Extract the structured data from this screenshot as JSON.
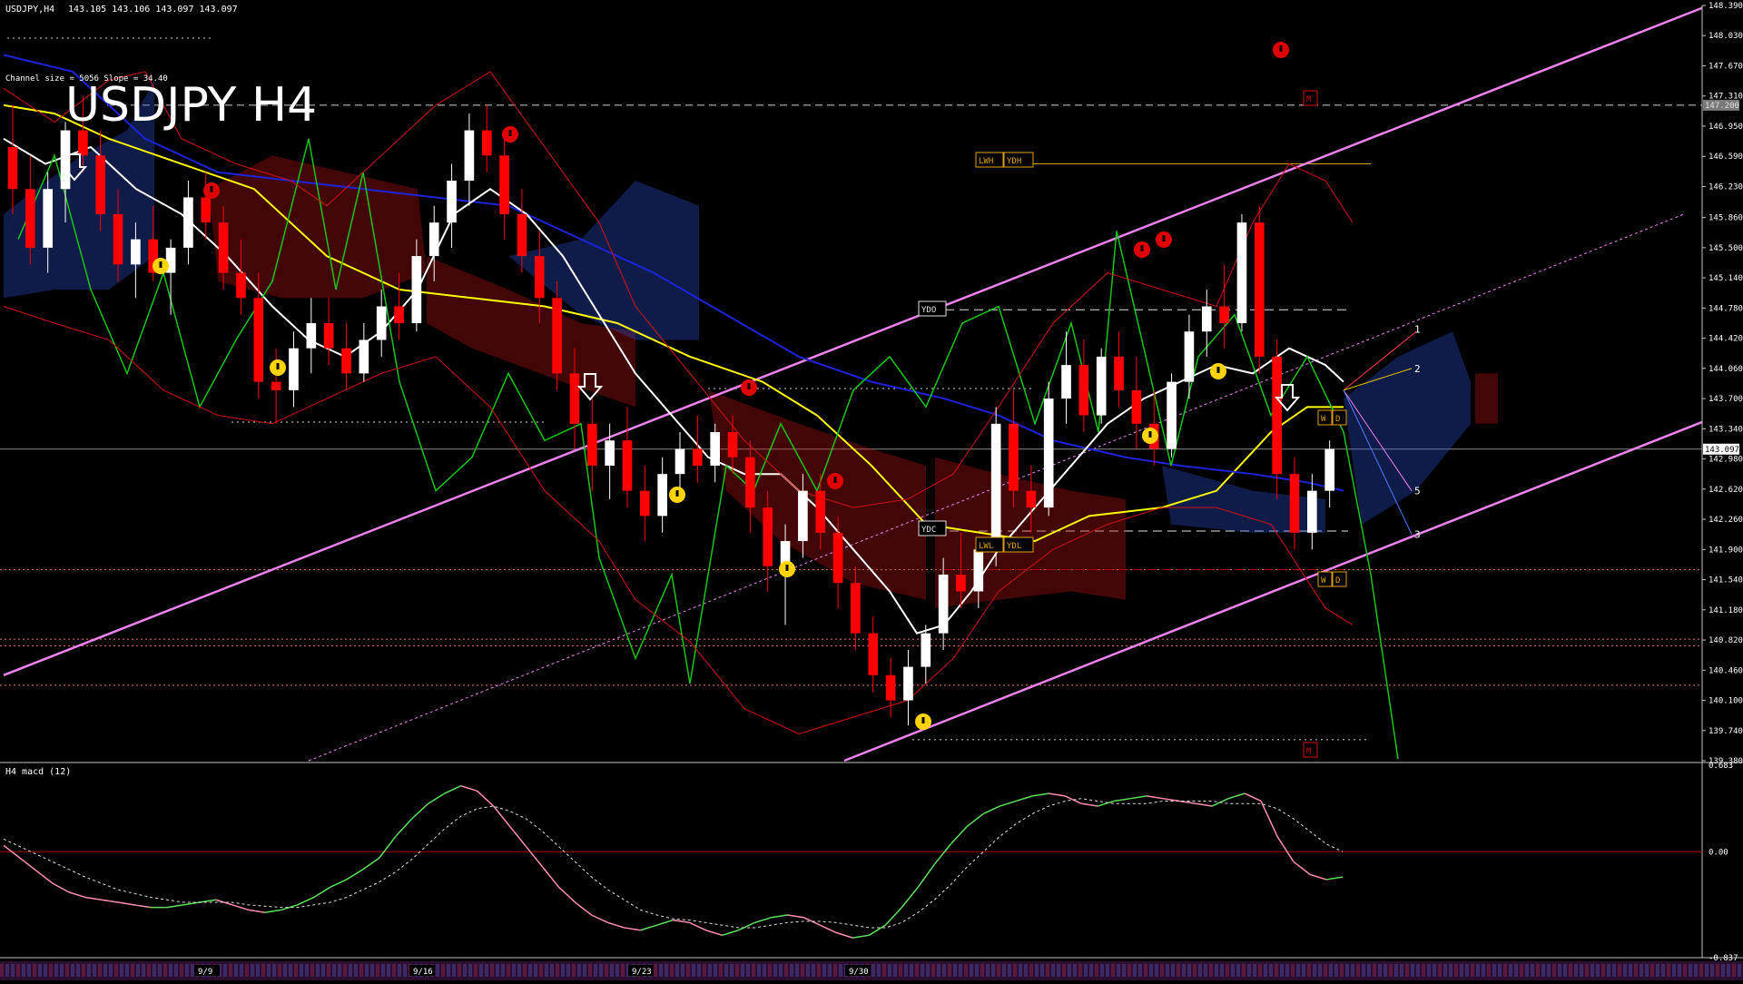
{
  "header": {
    "symbol_line": "USDJPY,H4",
    "ohlc": "143.105 143.106 143.097 143.097",
    "channel_info": "Channel size = 5056 Slope = 34.40"
  },
  "title": "USDJPY H4",
  "colors": {
    "background": "#000000",
    "bull": "#ffffff",
    "bear": "#ff0000",
    "channel": "#ee82ee",
    "ma_white": "#ffffff",
    "ma_yellow": "#ffff00",
    "ma_blue": "#1e22d8",
    "green_line": "#19c419",
    "macd_up": "#5ee05e",
    "macd_down": "#ff8fb0",
    "zero_line": "#b00000",
    "level_gray": "#cfcfcf",
    "level_pink": "#e07070",
    "level_orange": "#ffaa00"
  },
  "chart_data": {
    "type": "candlestick",
    "symbol": "USDJPY",
    "timeframe": "H4",
    "current_price": 143.097,
    "y_ticks": [
      "148.390",
      "148.030",
      "147.670",
      "147.310",
      "146.950",
      "146.590",
      "146.230",
      "145.860",
      "145.500",
      "145.140",
      "144.780",
      "144.420",
      "144.060",
      "143.700",
      "143.340",
      "142.980",
      "142.620",
      "142.260",
      "141.900",
      "141.540",
      "141.180",
      "140.820",
      "140.460",
      "140.100",
      "139.740",
      "139.380"
    ],
    "ylim": [
      139.38,
      148.39
    ],
    "price_label": "143.097",
    "label_147": "147.200",
    "x_labels": [
      "9/9",
      "9/16",
      "9/23",
      "9/30"
    ],
    "candles": [
      {
        "o": 146.7,
        "h": 147.2,
        "l": 145.9,
        "c": 146.2
      },
      {
        "o": 146.2,
        "h": 146.6,
        "l": 145.3,
        "c": 145.5
      },
      {
        "o": 145.5,
        "h": 146.4,
        "l": 145.2,
        "c": 146.2
      },
      {
        "o": 146.2,
        "h": 147.0,
        "l": 145.8,
        "c": 146.9
      },
      {
        "o": 146.9,
        "h": 147.3,
        "l": 146.4,
        "c": 146.6
      },
      {
        "o": 146.6,
        "h": 146.9,
        "l": 145.7,
        "c": 145.9
      },
      {
        "o": 145.9,
        "h": 146.2,
        "l": 145.1,
        "c": 145.3
      },
      {
        "o": 145.3,
        "h": 145.8,
        "l": 144.9,
        "c": 145.6
      },
      {
        "o": 145.6,
        "h": 146.0,
        "l": 145.1,
        "c": 145.2
      },
      {
        "o": 145.2,
        "h": 145.6,
        "l": 144.7,
        "c": 145.5
      },
      {
        "o": 145.5,
        "h": 146.3,
        "l": 145.3,
        "c": 146.1
      },
      {
        "o": 146.1,
        "h": 146.4,
        "l": 145.6,
        "c": 145.8
      },
      {
        "o": 145.8,
        "h": 146.0,
        "l": 145.0,
        "c": 145.2
      },
      {
        "o": 145.2,
        "h": 145.6,
        "l": 144.7,
        "c": 144.9
      },
      {
        "o": 144.9,
        "h": 145.2,
        "l": 143.7,
        "c": 143.9
      },
      {
        "o": 143.9,
        "h": 144.3,
        "l": 143.4,
        "c": 143.8
      },
      {
        "o": 143.8,
        "h": 144.5,
        "l": 143.6,
        "c": 144.3
      },
      {
        "o": 144.3,
        "h": 144.9,
        "l": 144.0,
        "c": 144.6
      },
      {
        "o": 144.6,
        "h": 144.9,
        "l": 144.1,
        "c": 144.3
      },
      {
        "o": 144.3,
        "h": 144.6,
        "l": 143.8,
        "c": 144.0
      },
      {
        "o": 144.0,
        "h": 144.6,
        "l": 143.9,
        "c": 144.4
      },
      {
        "o": 144.4,
        "h": 145.0,
        "l": 144.2,
        "c": 144.8
      },
      {
        "o": 144.8,
        "h": 145.2,
        "l": 144.4,
        "c": 144.6
      },
      {
        "o": 144.6,
        "h": 145.6,
        "l": 144.5,
        "c": 145.4
      },
      {
        "o": 145.4,
        "h": 146.0,
        "l": 145.1,
        "c": 145.8
      },
      {
        "o": 145.8,
        "h": 146.5,
        "l": 145.5,
        "c": 146.3
      },
      {
        "o": 146.3,
        "h": 147.1,
        "l": 146.0,
        "c": 146.9
      },
      {
        "o": 146.9,
        "h": 147.2,
        "l": 146.4,
        "c": 146.6
      },
      {
        "o": 146.6,
        "h": 146.8,
        "l": 145.6,
        "c": 145.9
      },
      {
        "o": 145.9,
        "h": 146.2,
        "l": 145.2,
        "c": 145.4
      },
      {
        "o": 145.4,
        "h": 145.7,
        "l": 144.6,
        "c": 144.9
      },
      {
        "o": 144.9,
        "h": 145.1,
        "l": 143.8,
        "c": 144.0
      },
      {
        "o": 144.0,
        "h": 144.3,
        "l": 143.1,
        "c": 143.4
      },
      {
        "o": 143.4,
        "h": 143.7,
        "l": 142.6,
        "c": 142.9
      },
      {
        "o": 142.9,
        "h": 143.4,
        "l": 142.5,
        "c": 143.2
      },
      {
        "o": 143.2,
        "h": 143.6,
        "l": 142.4,
        "c": 142.6
      },
      {
        "o": 142.6,
        "h": 142.9,
        "l": 142.0,
        "c": 142.3
      },
      {
        "o": 142.3,
        "h": 143.0,
        "l": 142.1,
        "c": 142.8
      },
      {
        "o": 142.8,
        "h": 143.3,
        "l": 142.6,
        "c": 143.1
      },
      {
        "o": 143.1,
        "h": 143.5,
        "l": 142.7,
        "c": 142.9
      },
      {
        "o": 142.9,
        "h": 143.4,
        "l": 142.7,
        "c": 143.3
      },
      {
        "o": 143.3,
        "h": 143.5,
        "l": 142.8,
        "c": 143.0
      },
      {
        "o": 143.0,
        "h": 143.2,
        "l": 142.1,
        "c": 142.4
      },
      {
        "o": 142.4,
        "h": 142.6,
        "l": 141.4,
        "c": 141.7
      },
      {
        "o": 141.7,
        "h": 142.2,
        "l": 141.0,
        "c": 142.0
      },
      {
        "o": 142.0,
        "h": 142.8,
        "l": 141.8,
        "c": 142.6
      },
      {
        "o": 142.6,
        "h": 142.8,
        "l": 141.9,
        "c": 142.1
      },
      {
        "o": 142.1,
        "h": 142.3,
        "l": 141.2,
        "c": 141.5
      },
      {
        "o": 141.5,
        "h": 141.7,
        "l": 140.7,
        "c": 140.9
      },
      {
        "o": 140.9,
        "h": 141.1,
        "l": 140.2,
        "c": 140.4
      },
      {
        "o": 140.4,
        "h": 140.6,
        "l": 139.9,
        "c": 140.1
      },
      {
        "o": 140.1,
        "h": 140.7,
        "l": 139.8,
        "c": 140.5
      },
      {
        "o": 140.5,
        "h": 141.0,
        "l": 140.3,
        "c": 140.9
      },
      {
        "o": 140.9,
        "h": 141.8,
        "l": 140.7,
        "c": 141.6
      },
      {
        "o": 141.6,
        "h": 142.1,
        "l": 141.2,
        "c": 141.4
      },
      {
        "o": 141.4,
        "h": 142.0,
        "l": 141.2,
        "c": 141.9
      },
      {
        "o": 141.9,
        "h": 143.6,
        "l": 141.7,
        "c": 143.4
      },
      {
        "o": 143.4,
        "h": 143.8,
        "l": 142.4,
        "c": 142.6
      },
      {
        "o": 142.6,
        "h": 142.9,
        "l": 142.1,
        "c": 142.4
      },
      {
        "o": 142.4,
        "h": 143.9,
        "l": 142.3,
        "c": 143.7
      },
      {
        "o": 143.7,
        "h": 144.5,
        "l": 143.4,
        "c": 144.1
      },
      {
        "o": 144.1,
        "h": 144.4,
        "l": 143.3,
        "c": 143.5
      },
      {
        "o": 143.5,
        "h": 144.3,
        "l": 143.4,
        "c": 144.2
      },
      {
        "o": 144.2,
        "h": 144.5,
        "l": 143.6,
        "c": 143.8
      },
      {
        "o": 143.8,
        "h": 144.2,
        "l": 143.1,
        "c": 143.4
      },
      {
        "o": 143.4,
        "h": 143.8,
        "l": 142.9,
        "c": 143.1
      },
      {
        "o": 143.1,
        "h": 144.0,
        "l": 143.0,
        "c": 143.9
      },
      {
        "o": 143.9,
        "h": 144.7,
        "l": 143.7,
        "c": 144.5
      },
      {
        "o": 144.5,
        "h": 145.0,
        "l": 144.2,
        "c": 144.8
      },
      {
        "o": 144.8,
        "h": 145.3,
        "l": 144.3,
        "c": 144.6
      },
      {
        "o": 144.6,
        "h": 145.9,
        "l": 144.5,
        "c": 145.8
      },
      {
        "o": 145.8,
        "h": 146.0,
        "l": 144.0,
        "c": 144.2
      },
      {
        "o": 144.2,
        "h": 144.4,
        "l": 142.5,
        "c": 142.8
      },
      {
        "o": 142.8,
        "h": 143.0,
        "l": 141.9,
        "c": 142.1
      },
      {
        "o": 142.1,
        "h": 142.8,
        "l": 141.9,
        "c": 142.6
      },
      {
        "o": 142.6,
        "h": 143.2,
        "l": 142.4,
        "c": 143.1
      }
    ],
    "macd": {
      "name": "H4 macd (12)",
      "ylim": [
        -0.837,
        0.683
      ],
      "y_ticks": [
        "0.683",
        "0.00",
        "-0.837"
      ],
      "main": [
        0.05,
        -0.05,
        -0.15,
        -0.25,
        -0.32,
        -0.36,
        -0.38,
        -0.4,
        -0.42,
        -0.44,
        -0.44,
        -0.42,
        -0.4,
        -0.38,
        -0.42,
        -0.46,
        -0.48,
        -0.46,
        -0.42,
        -0.36,
        -0.28,
        -0.22,
        -0.14,
        -0.05,
        0.12,
        0.26,
        0.38,
        0.46,
        0.52,
        0.48,
        0.36,
        0.2,
        0.04,
        -0.12,
        -0.28,
        -0.4,
        -0.5,
        -0.56,
        -0.6,
        -0.62,
        -0.58,
        -0.54,
        -0.56,
        -0.62,
        -0.66,
        -0.62,
        -0.56,
        -0.52,
        -0.5,
        -0.52,
        -0.58,
        -0.64,
        -0.68,
        -0.66,
        -0.58,
        -0.44,
        -0.28,
        -0.1,
        0.06,
        0.2,
        0.3,
        0.36,
        0.4,
        0.44,
        0.46,
        0.44,
        0.38,
        0.36,
        0.4,
        0.42,
        0.44,
        0.42,
        0.4,
        0.38,
        0.36,
        0.42,
        0.46,
        0.4,
        0.12,
        -0.08,
        -0.18,
        -0.22,
        -0.2
      ],
      "signal": [
        0.1,
        0.04,
        -0.02,
        -0.08,
        -0.14,
        -0.2,
        -0.25,
        -0.3,
        -0.33,
        -0.36,
        -0.38,
        -0.4,
        -0.4,
        -0.4,
        -0.4,
        -0.42,
        -0.43,
        -0.44,
        -0.44,
        -0.42,
        -0.4,
        -0.36,
        -0.3,
        -0.24,
        -0.16,
        -0.06,
        0.06,
        0.18,
        0.28,
        0.34,
        0.36,
        0.32,
        0.26,
        0.16,
        0.04,
        -0.08,
        -0.2,
        -0.3,
        -0.38,
        -0.46,
        -0.5,
        -0.53,
        -0.54,
        -0.56,
        -0.58,
        -0.6,
        -0.6,
        -0.58,
        -0.56,
        -0.55,
        -0.55,
        -0.56,
        -0.58,
        -0.6,
        -0.6,
        -0.56,
        -0.48,
        -0.38,
        -0.26,
        -0.12,
        0.0,
        0.12,
        0.22,
        0.3,
        0.36,
        0.4,
        0.42,
        0.4,
        0.38,
        0.38,
        0.38,
        0.4,
        0.4,
        0.4,
        0.4,
        0.38,
        0.38,
        0.38,
        0.34,
        0.26,
        0.16,
        0.06,
        0.0
      ]
    },
    "wave_labels": [
      "1",
      "2",
      "3",
      "5"
    ],
    "box_labels": [
      "YDO",
      "YDC",
      "LWH",
      "YDH",
      "LWL",
      "YDL",
      "M",
      "W",
      "D"
    ],
    "level_labels": {
      "ydo": "YDO",
      "ydc": "YDC",
      "lwh": "LWH",
      "ydh": "YDH",
      "lwl": "LWL",
      "ydl": "YDL",
      "m": "M",
      "w": "W",
      "d": "D"
    }
  }
}
